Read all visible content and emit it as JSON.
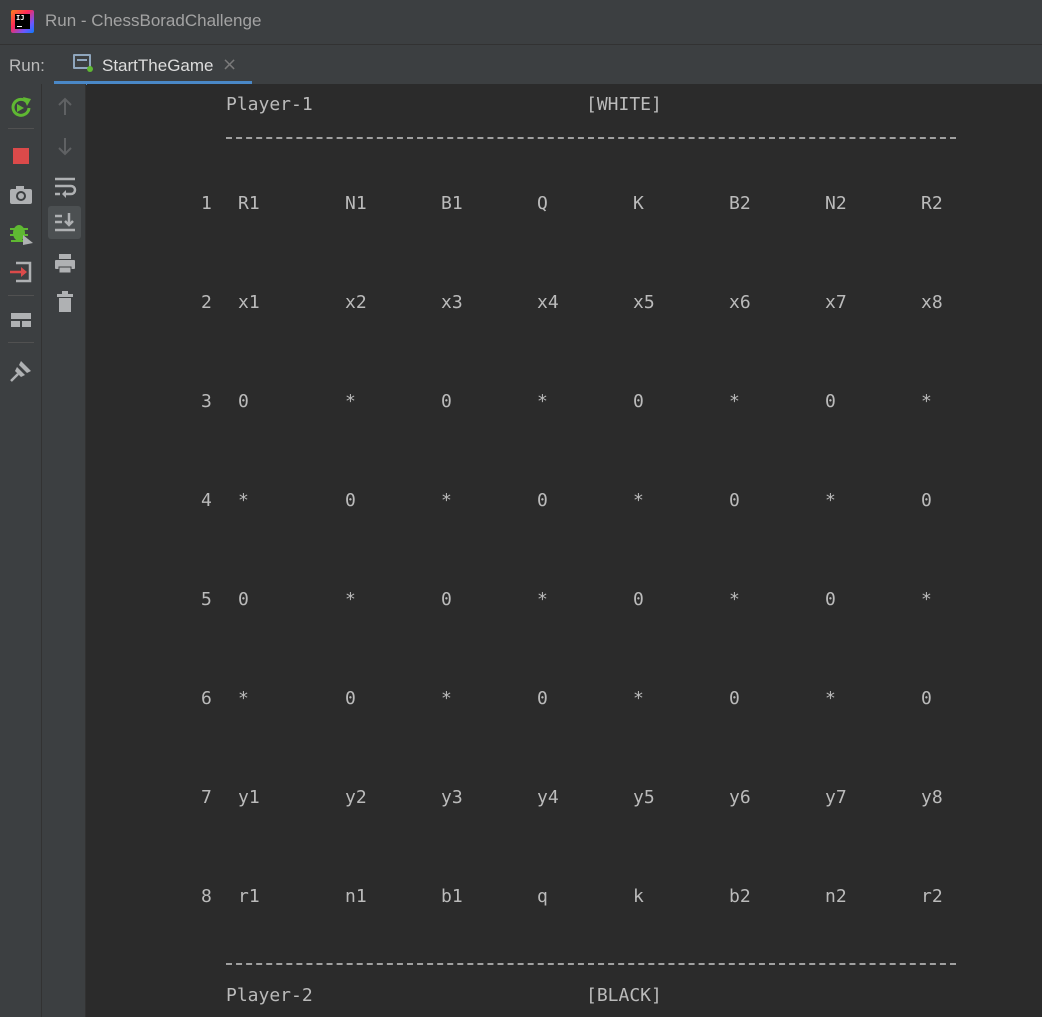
{
  "window": {
    "title": "Run - ChessBoradChallenge"
  },
  "run_panel": {
    "label": "Run:",
    "tab": {
      "label": "StartTheGame",
      "close": "×"
    }
  },
  "toolbar_left": [
    {
      "name": "rerun-icon",
      "glyph": "↻"
    },
    {
      "name": "stop-icon",
      "glyph": "■"
    },
    {
      "name": "camera-icon",
      "glyph": "◉"
    },
    {
      "name": "debug-icon",
      "glyph": "✱"
    },
    {
      "name": "import-icon",
      "glyph": "⇥"
    },
    {
      "name": "layout-icon",
      "glyph": "▦"
    },
    {
      "name": "pin-icon",
      "glyph": "📌"
    }
  ],
  "toolbar_right": [
    {
      "name": "up-arrow-icon",
      "glyph": "↑"
    },
    {
      "name": "down-arrow-icon",
      "glyph": "↓"
    },
    {
      "name": "soft-wrap-icon",
      "glyph": "⏎"
    },
    {
      "name": "scroll-to-end-icon",
      "glyph": "⤓"
    },
    {
      "name": "print-icon",
      "glyph": "⎙"
    },
    {
      "name": "trash-icon",
      "glyph": "🗑"
    }
  ],
  "console": {
    "player1": {
      "name": "Player-1",
      "color": "[WHITE]"
    },
    "player2": {
      "name": "Player-2",
      "color": "[BLACK]"
    },
    "separator": "--------------------------------------------------------------",
    "rows": [
      {
        "num": "1",
        "cells": [
          "R1",
          "N1",
          "B1",
          "Q",
          "K",
          "B2",
          "N2",
          "R2"
        ]
      },
      {
        "num": "2",
        "cells": [
          "x1",
          "x2",
          "x3",
          "x4",
          "x5",
          "x6",
          "x7",
          "x8"
        ]
      },
      {
        "num": "3",
        "cells": [
          "0",
          "*",
          "0",
          "*",
          "0",
          "*",
          "0",
          "*"
        ]
      },
      {
        "num": "4",
        "cells": [
          "*",
          "0",
          "*",
          "0",
          "*",
          "0",
          "*",
          "0"
        ]
      },
      {
        "num": "5",
        "cells": [
          "0",
          "*",
          "0",
          "*",
          "0",
          "*",
          "0",
          "*"
        ]
      },
      {
        "num": "6",
        "cells": [
          "*",
          "0",
          "*",
          "0",
          "*",
          "0",
          "*",
          "0"
        ]
      },
      {
        "num": "7",
        "cells": [
          "y1",
          "y2",
          "y3",
          "y4",
          "y5",
          "y6",
          "y7",
          "y8"
        ]
      },
      {
        "num": "8",
        "cells": [
          "r1",
          "n1",
          "b1",
          "q",
          "k",
          "b2",
          "n2",
          "r2"
        ]
      }
    ]
  },
  "colors": {
    "background": "#2b2b2b",
    "panel": "#3c3f41",
    "text": "#bbbbbb",
    "tab_underline": "#4a88c7"
  }
}
